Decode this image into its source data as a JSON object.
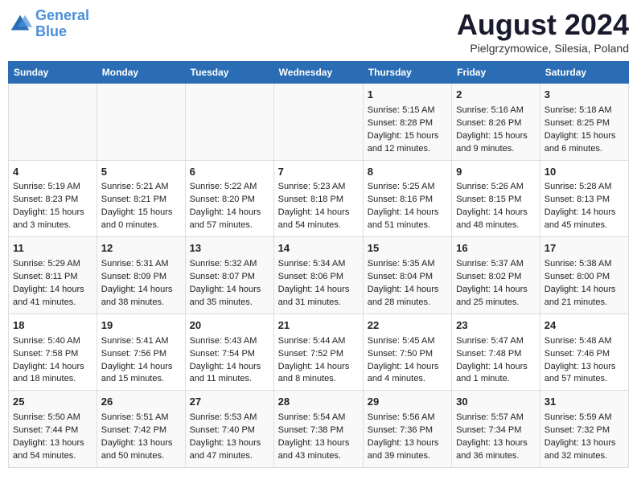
{
  "header": {
    "logo_line1": "General",
    "logo_line2": "Blue",
    "month": "August 2024",
    "location": "Pielgrzymowice, Silesia, Poland"
  },
  "weekdays": [
    "Sunday",
    "Monday",
    "Tuesday",
    "Wednesday",
    "Thursday",
    "Friday",
    "Saturday"
  ],
  "weeks": [
    [
      {
        "day": "",
        "info": ""
      },
      {
        "day": "",
        "info": ""
      },
      {
        "day": "",
        "info": ""
      },
      {
        "day": "",
        "info": ""
      },
      {
        "day": "1",
        "info": "Sunrise: 5:15 AM\nSunset: 8:28 PM\nDaylight: 15 hours\nand 12 minutes."
      },
      {
        "day": "2",
        "info": "Sunrise: 5:16 AM\nSunset: 8:26 PM\nDaylight: 15 hours\nand 9 minutes."
      },
      {
        "day": "3",
        "info": "Sunrise: 5:18 AM\nSunset: 8:25 PM\nDaylight: 15 hours\nand 6 minutes."
      }
    ],
    [
      {
        "day": "4",
        "info": "Sunrise: 5:19 AM\nSunset: 8:23 PM\nDaylight: 15 hours\nand 3 minutes."
      },
      {
        "day": "5",
        "info": "Sunrise: 5:21 AM\nSunset: 8:21 PM\nDaylight: 15 hours\nand 0 minutes."
      },
      {
        "day": "6",
        "info": "Sunrise: 5:22 AM\nSunset: 8:20 PM\nDaylight: 14 hours\nand 57 minutes."
      },
      {
        "day": "7",
        "info": "Sunrise: 5:23 AM\nSunset: 8:18 PM\nDaylight: 14 hours\nand 54 minutes."
      },
      {
        "day": "8",
        "info": "Sunrise: 5:25 AM\nSunset: 8:16 PM\nDaylight: 14 hours\nand 51 minutes."
      },
      {
        "day": "9",
        "info": "Sunrise: 5:26 AM\nSunset: 8:15 PM\nDaylight: 14 hours\nand 48 minutes."
      },
      {
        "day": "10",
        "info": "Sunrise: 5:28 AM\nSunset: 8:13 PM\nDaylight: 14 hours\nand 45 minutes."
      }
    ],
    [
      {
        "day": "11",
        "info": "Sunrise: 5:29 AM\nSunset: 8:11 PM\nDaylight: 14 hours\nand 41 minutes."
      },
      {
        "day": "12",
        "info": "Sunrise: 5:31 AM\nSunset: 8:09 PM\nDaylight: 14 hours\nand 38 minutes."
      },
      {
        "day": "13",
        "info": "Sunrise: 5:32 AM\nSunset: 8:07 PM\nDaylight: 14 hours\nand 35 minutes."
      },
      {
        "day": "14",
        "info": "Sunrise: 5:34 AM\nSunset: 8:06 PM\nDaylight: 14 hours\nand 31 minutes."
      },
      {
        "day": "15",
        "info": "Sunrise: 5:35 AM\nSunset: 8:04 PM\nDaylight: 14 hours\nand 28 minutes."
      },
      {
        "day": "16",
        "info": "Sunrise: 5:37 AM\nSunset: 8:02 PM\nDaylight: 14 hours\nand 25 minutes."
      },
      {
        "day": "17",
        "info": "Sunrise: 5:38 AM\nSunset: 8:00 PM\nDaylight: 14 hours\nand 21 minutes."
      }
    ],
    [
      {
        "day": "18",
        "info": "Sunrise: 5:40 AM\nSunset: 7:58 PM\nDaylight: 14 hours\nand 18 minutes."
      },
      {
        "day": "19",
        "info": "Sunrise: 5:41 AM\nSunset: 7:56 PM\nDaylight: 14 hours\nand 15 minutes."
      },
      {
        "day": "20",
        "info": "Sunrise: 5:43 AM\nSunset: 7:54 PM\nDaylight: 14 hours\nand 11 minutes."
      },
      {
        "day": "21",
        "info": "Sunrise: 5:44 AM\nSunset: 7:52 PM\nDaylight: 14 hours\nand 8 minutes."
      },
      {
        "day": "22",
        "info": "Sunrise: 5:45 AM\nSunset: 7:50 PM\nDaylight: 14 hours\nand 4 minutes."
      },
      {
        "day": "23",
        "info": "Sunrise: 5:47 AM\nSunset: 7:48 PM\nDaylight: 14 hours\nand 1 minute."
      },
      {
        "day": "24",
        "info": "Sunrise: 5:48 AM\nSunset: 7:46 PM\nDaylight: 13 hours\nand 57 minutes."
      }
    ],
    [
      {
        "day": "25",
        "info": "Sunrise: 5:50 AM\nSunset: 7:44 PM\nDaylight: 13 hours\nand 54 minutes."
      },
      {
        "day": "26",
        "info": "Sunrise: 5:51 AM\nSunset: 7:42 PM\nDaylight: 13 hours\nand 50 minutes."
      },
      {
        "day": "27",
        "info": "Sunrise: 5:53 AM\nSunset: 7:40 PM\nDaylight: 13 hours\nand 47 minutes."
      },
      {
        "day": "28",
        "info": "Sunrise: 5:54 AM\nSunset: 7:38 PM\nDaylight: 13 hours\nand 43 minutes."
      },
      {
        "day": "29",
        "info": "Sunrise: 5:56 AM\nSunset: 7:36 PM\nDaylight: 13 hours\nand 39 minutes."
      },
      {
        "day": "30",
        "info": "Sunrise: 5:57 AM\nSunset: 7:34 PM\nDaylight: 13 hours\nand 36 minutes."
      },
      {
        "day": "31",
        "info": "Sunrise: 5:59 AM\nSunset: 7:32 PM\nDaylight: 13 hours\nand 32 minutes."
      }
    ]
  ]
}
